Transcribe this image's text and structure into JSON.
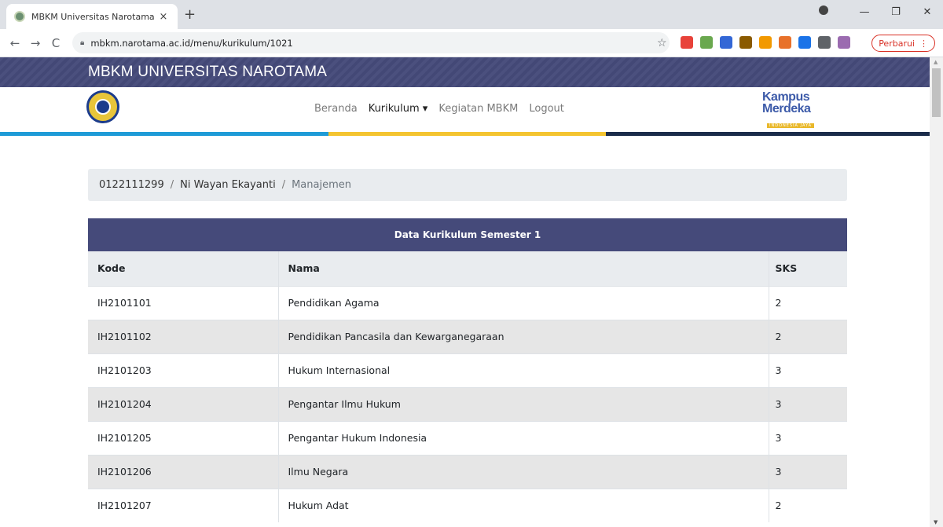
{
  "browser": {
    "tab_title": "MBKM Universitas Narotama",
    "tab_close": "×",
    "new_tab": "+",
    "url": "mbkm.narotama.ac.id/menu/kurikulum/1021",
    "update_label": "Perbarui",
    "update_more": "⋮",
    "back": "←",
    "forward": "→",
    "reload": "C",
    "star": "☆",
    "minimize": "—",
    "restore": "❐",
    "close": "✕",
    "extension_colors": [
      "#e8423a",
      "#6aa84f",
      "#3367d6",
      "#8a5a00",
      "#f29900",
      "#e8712a",
      "#1a73e8",
      "#5f6368",
      "#9b6bb0"
    ]
  },
  "site": {
    "title": "MBKM UNIVERSITAS NAROTAMA",
    "kampus_line1": "Kampus",
    "kampus_line2": "Merdeka",
    "kampus_line3": "INDONESIA JAYA",
    "stripe_colors": [
      "#1e9bd7",
      "#f4c430",
      "#1b2c4a"
    ]
  },
  "nav": {
    "beranda": "Beranda",
    "kurikulum": "Kurikulum",
    "kurikulum_caret": "▾",
    "kegiatan": "Kegiatan MBKM",
    "logout": "Logout"
  },
  "breadcrumb": {
    "nim": "0122111299",
    "nama": "Ni Wayan Ekayanti",
    "prodi": "Manajemen",
    "separator": "/"
  },
  "table": {
    "caption": "Data Kurikulum Semester 1",
    "headers": {
      "kode": "Kode",
      "nama": "Nama",
      "sks": "SKS"
    },
    "rows": [
      {
        "kode": "IH2101101",
        "nama": "Pendidikan Agama",
        "sks": "2"
      },
      {
        "kode": "IH2101102",
        "nama": "Pendidikan Pancasila dan Kewarganegaraan",
        "sks": "2"
      },
      {
        "kode": "IH2101203",
        "nama": "Hukum Internasional",
        "sks": "3"
      },
      {
        "kode": "IH2101204",
        "nama": "Pengantar Ilmu Hukum",
        "sks": "3"
      },
      {
        "kode": "IH2101205",
        "nama": "Pengantar Hukum Indonesia",
        "sks": "3"
      },
      {
        "kode": "IH2101206",
        "nama": "Ilmu Negara",
        "sks": "3"
      },
      {
        "kode": "IH2101207",
        "nama": "Hukum Adat",
        "sks": "2"
      }
    ]
  }
}
